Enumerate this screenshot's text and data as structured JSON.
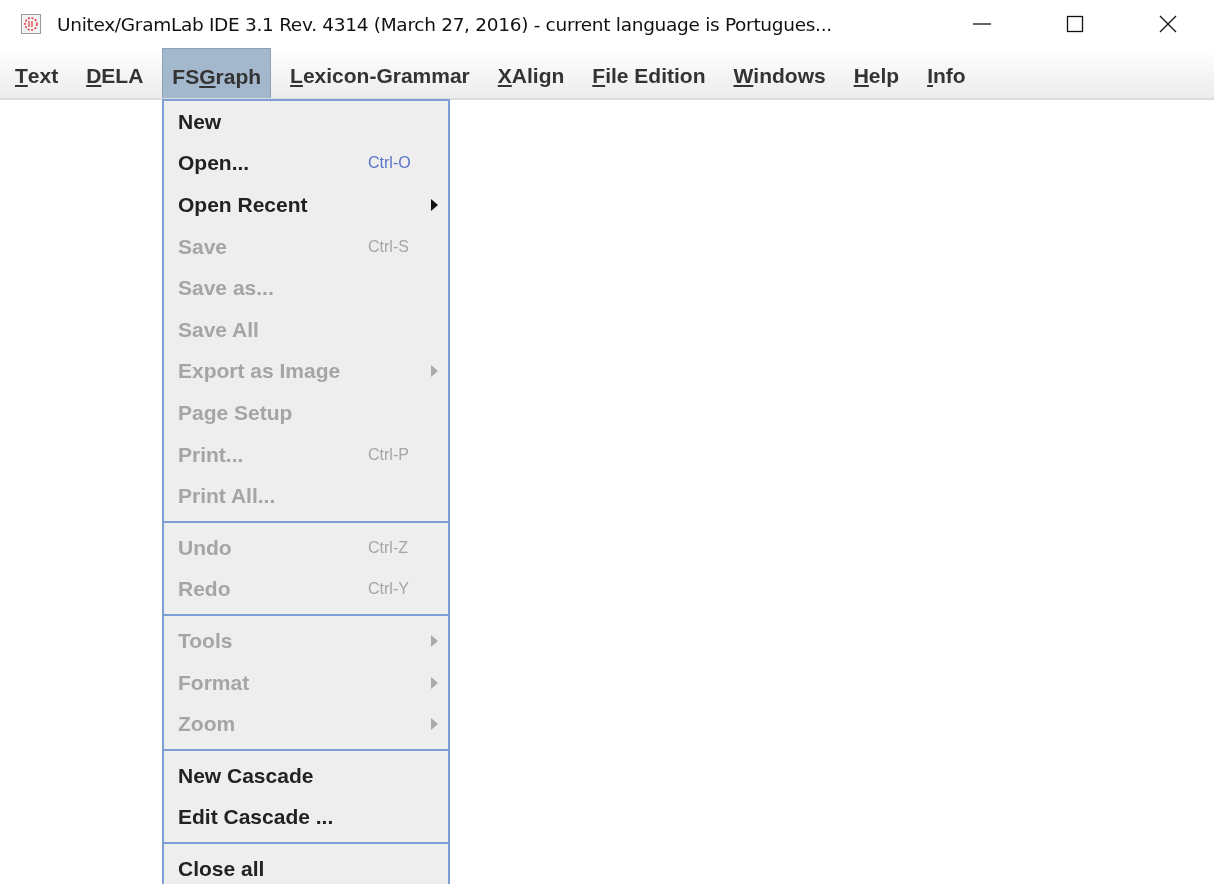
{
  "window": {
    "title": "Unitex/GramLab IDE 3.1  Rev. 4314 (March 27, 2016) - current language is Portugues..."
  },
  "menu_bar": [
    {
      "key": "T",
      "after": "ext",
      "selected": false
    },
    {
      "key": "D",
      "after": "ELA",
      "selected": false
    },
    {
      "before": "FS",
      "key": "G",
      "after": "raph",
      "selected": true
    },
    {
      "key": "L",
      "after": "exicon-Grammar",
      "selected": false
    },
    {
      "key": "X",
      "after": "Align",
      "selected": false
    },
    {
      "key": "F",
      "after": "ile Edition",
      "selected": false
    },
    {
      "key": "W",
      "after": "indows",
      "selected": false
    },
    {
      "key": "H",
      "after": "elp",
      "selected": false
    },
    {
      "key": "I",
      "after": "nfo",
      "selected": false
    }
  ],
  "dropdown": {
    "sections": [
      [
        {
          "label": "New",
          "disabled": false,
          "submenu": false
        },
        {
          "label": "Open...",
          "shortcut": "Ctrl-O",
          "disabled": false,
          "submenu": false
        },
        {
          "label": "Open Recent",
          "disabled": false,
          "submenu": true
        },
        {
          "label": "Save",
          "shortcut": "Ctrl-S",
          "disabled": true,
          "submenu": false
        },
        {
          "label": "Save as...",
          "disabled": true,
          "submenu": false
        },
        {
          "label": "Save All",
          "disabled": true,
          "submenu": false
        },
        {
          "label": "Export as Image",
          "disabled": true,
          "submenu": true
        },
        {
          "label": "Page Setup",
          "disabled": true,
          "submenu": false
        },
        {
          "label": "Print...",
          "shortcut": "Ctrl-P",
          "disabled": true,
          "submenu": false
        },
        {
          "label": "Print All...",
          "disabled": true,
          "submenu": false
        }
      ],
      [
        {
          "label": "Undo",
          "shortcut": "Ctrl-Z",
          "disabled": true,
          "submenu": false
        },
        {
          "label": "Redo",
          "shortcut": "Ctrl-Y",
          "disabled": true,
          "submenu": false
        }
      ],
      [
        {
          "label": "Tools",
          "disabled": true,
          "submenu": true
        },
        {
          "label": "Format",
          "disabled": true,
          "submenu": true
        },
        {
          "label": "Zoom",
          "disabled": true,
          "submenu": true
        }
      ],
      [
        {
          "label": "New Cascade",
          "disabled": false,
          "submenu": false
        },
        {
          "label": "Edit Cascade ...",
          "disabled": false,
          "submenu": false
        }
      ],
      [
        {
          "label": "Close all",
          "disabled": false,
          "submenu": false
        }
      ]
    ]
  }
}
